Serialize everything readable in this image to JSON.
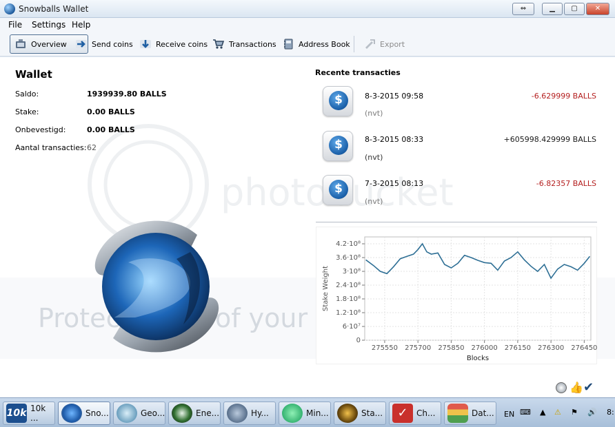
{
  "window": {
    "title": "Snowballs Wallet"
  },
  "menu": [
    "File",
    "Settings",
    "Help"
  ],
  "toolbar": {
    "overview": "Overview",
    "send": "Send coins",
    "receive": "Receive coins",
    "transactions": "Transactions",
    "address_book": "Address Book",
    "export": "Export"
  },
  "wallet": {
    "title": "Wallet",
    "saldo_label": "Saldo:",
    "saldo_value": "1939939.80 BALLS",
    "stake_label": "Stake:",
    "stake_value": "0.00 BALLS",
    "unconfirmed_label": "Onbevestigd:",
    "unconfirmed_value": "0.00 BALLS",
    "tx_count_label": "Aantal transacties:",
    "tx_count_value": "62"
  },
  "recent": {
    "title": "Recente transacties",
    "items": [
      {
        "date": "8-3-2015 09:58",
        "note": "(nvt)",
        "amount": "-6.629999 BALLS"
      },
      {
        "date": "8-3-2015 08:33",
        "note": "(nvt)",
        "amount": "+605998.429999 BALLS"
      },
      {
        "date": "7-3-2015 08:13",
        "note": "(nvt)",
        "amount": "-6.82357 BALLS"
      }
    ]
  },
  "chart_data": {
    "type": "line",
    "xlabel": "Blocks",
    "ylabel": "Stake Weight",
    "xlim": [
      275460,
      276480
    ],
    "ylim": [
      0,
      450000000
    ],
    "xticks": [
      "275550",
      "275700",
      "275850",
      "276000",
      "276150",
      "276300",
      "276450"
    ],
    "xtick_values": [
      275550,
      275700,
      275850,
      276000,
      276150,
      276300,
      276450
    ],
    "yticks": [
      "0",
      "6·10⁷",
      "1.2·10⁸",
      "1.8·10⁸",
      "2.4·10⁸",
      "3·10⁸",
      "3.6·10⁸",
      "4.2·10⁸"
    ],
    "ytick_values": [
      0,
      60000000,
      120000000,
      180000000,
      240000000,
      300000000,
      360000000,
      420000000
    ],
    "grid": true,
    "series": [
      {
        "x": [
          275465,
          275500,
          275530,
          275560,
          275590,
          275620,
          275650,
          275680,
          275700,
          275720,
          275740,
          275760,
          275790,
          275820,
          275850,
          275880,
          275910,
          275940,
          275970,
          276000,
          276030,
          276060,
          276090,
          276120,
          276150,
          276180,
          276210,
          276240,
          276270,
          276300,
          276330,
          276360,
          276390,
          276420,
          276450,
          276475
        ],
        "values": [
          350000000,
          325000000,
          300000000,
          290000000,
          320000000,
          355000000,
          365000000,
          375000000,
          395000000,
          420000000,
          385000000,
          375000000,
          380000000,
          330000000,
          315000000,
          335000000,
          370000000,
          360000000,
          348000000,
          338000000,
          335000000,
          305000000,
          345000000,
          360000000,
          385000000,
          350000000,
          322000000,
          300000000,
          330000000,
          270000000,
          310000000,
          330000000,
          320000000,
          305000000,
          335000000,
          365000000
        ]
      }
    ]
  },
  "taskbar": {
    "items": [
      "10k ...",
      "Sno...",
      "Geo...",
      "Ene...",
      "Hy...",
      "Min...",
      "Sta...",
      "Ch...",
      "Dat..."
    ],
    "language": "EN",
    "clock": "8:"
  },
  "watermark": {
    "top": "photobucket",
    "bottom": "Protect more of your memories"
  },
  "colors": {
    "accent": "#1a5fa8",
    "negative": "#b41e1e",
    "chart_line": "#2e6f95"
  }
}
